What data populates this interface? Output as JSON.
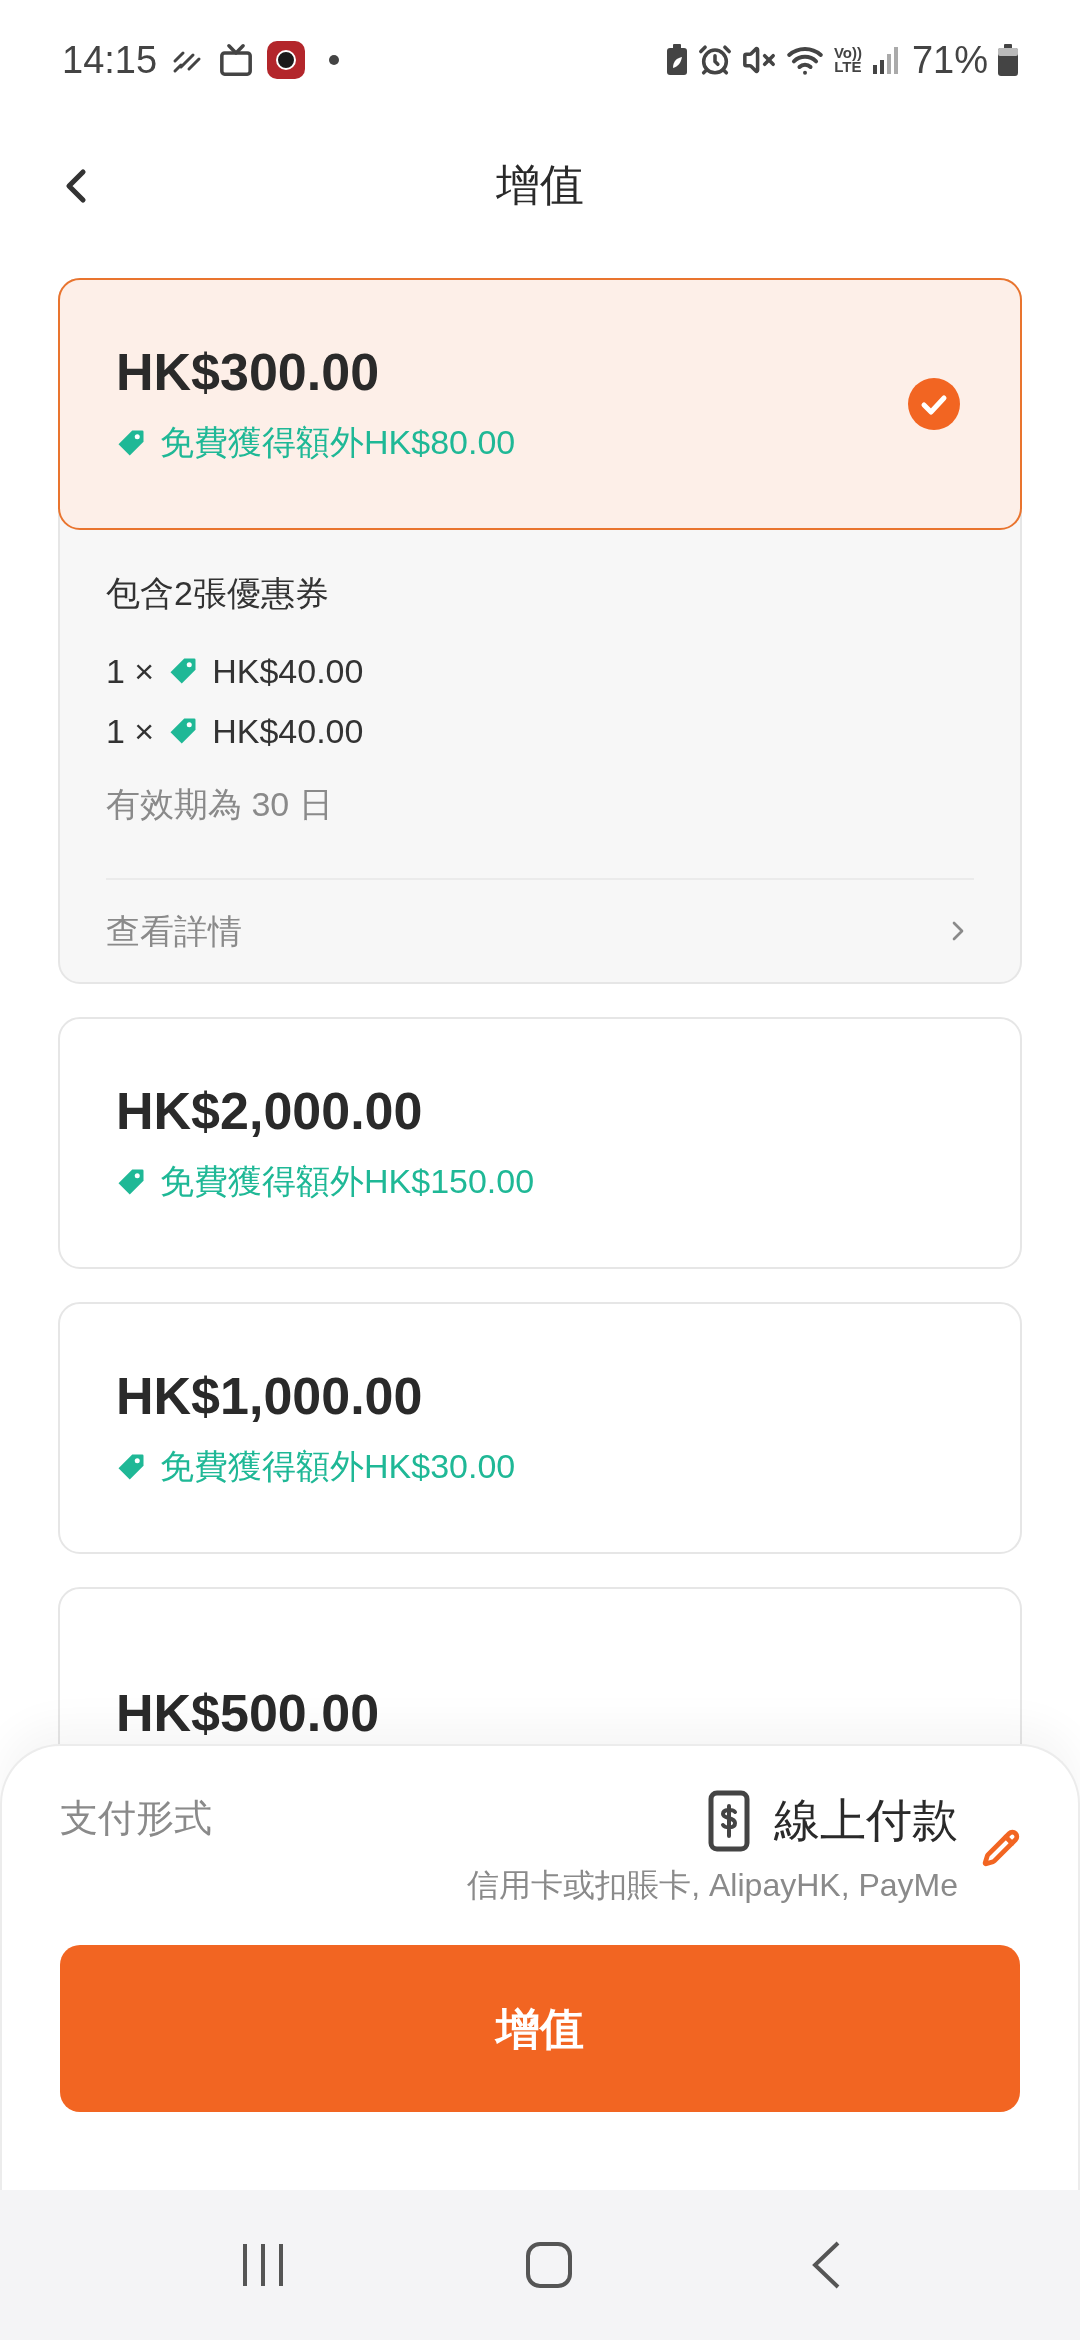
{
  "status_bar": {
    "time": "14:15",
    "volte_label": "Vo))",
    "network_label": "LTE",
    "battery": "71%"
  },
  "header": {
    "title": "增值"
  },
  "packages": [
    {
      "amount": "HK$300.00",
      "bonus": "免費獲得額外HK$80.00",
      "selected": true,
      "details": {
        "coupon_summary": "包含2張優惠券",
        "coupons": [
          {
            "quantity": "1 ×",
            "value": "HK$40.00"
          },
          {
            "quantity": "1 ×",
            "value": "HK$40.00"
          }
        ],
        "validity": "有效期為 30 日",
        "link": "查看詳情"
      }
    },
    {
      "amount": "HK$2,000.00",
      "bonus": "免費獲得額外HK$150.00",
      "selected": false
    },
    {
      "amount": "HK$1,000.00",
      "bonus": "免費獲得額外HK$30.00",
      "selected": false
    },
    {
      "amount": "HK$500.00",
      "selected": false
    }
  ],
  "payment": {
    "label": "支付形式",
    "method": "線上付款",
    "description": "信用卡或扣賬卡, AlipayHK, PayMe"
  },
  "submit_button": "增值"
}
